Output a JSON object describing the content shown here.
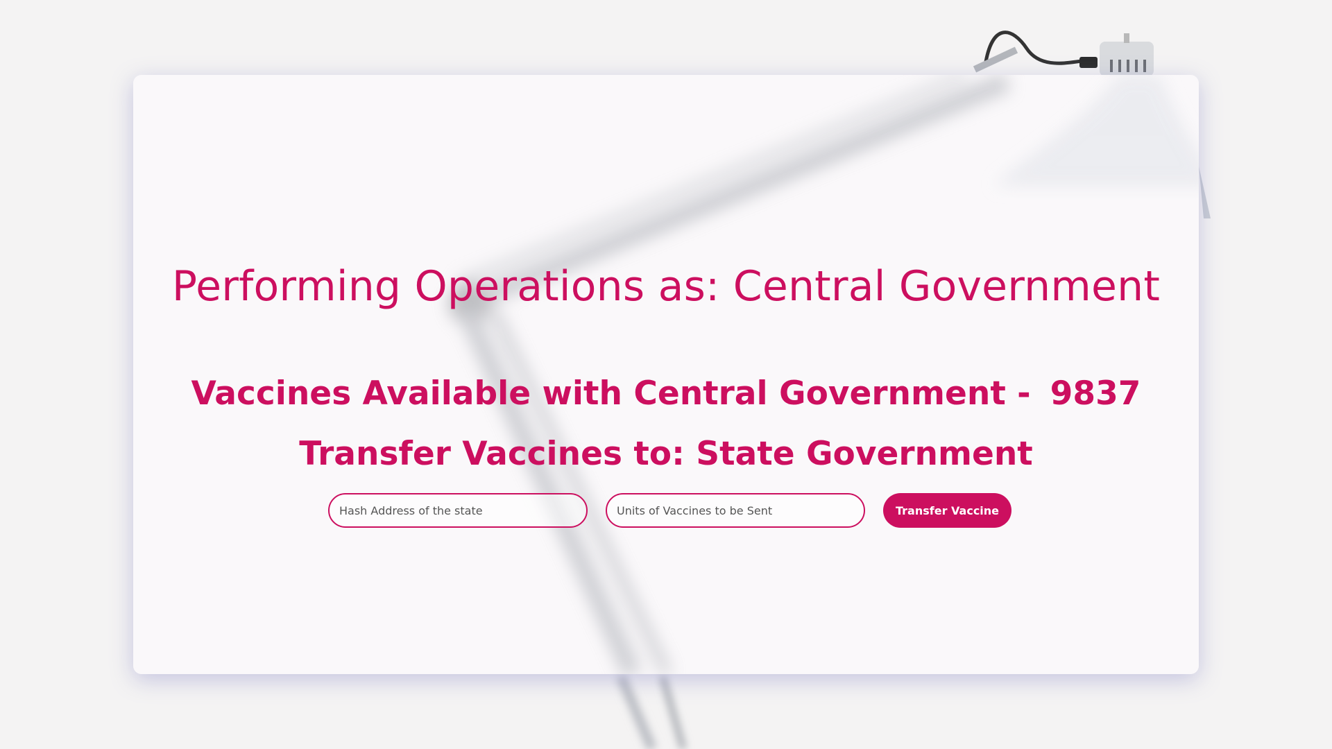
{
  "colors": {
    "accent": "#cc0f5f",
    "background": "#f4f3f3",
    "card": "#faf8fa"
  },
  "heading": {
    "title": "Performing Operations as: Central Government"
  },
  "vaccines": {
    "available_label": "Vaccines Available with Central Government -",
    "available_count": "9837"
  },
  "transfer": {
    "heading": "Transfer Vaccines to: State Government",
    "address_placeholder": "Hash Address of the state",
    "units_placeholder": "Units of Vaccines to be Sent",
    "button_label": "Transfer Vaccine"
  },
  "background_image": {
    "icon": "desk-lamp-image"
  }
}
